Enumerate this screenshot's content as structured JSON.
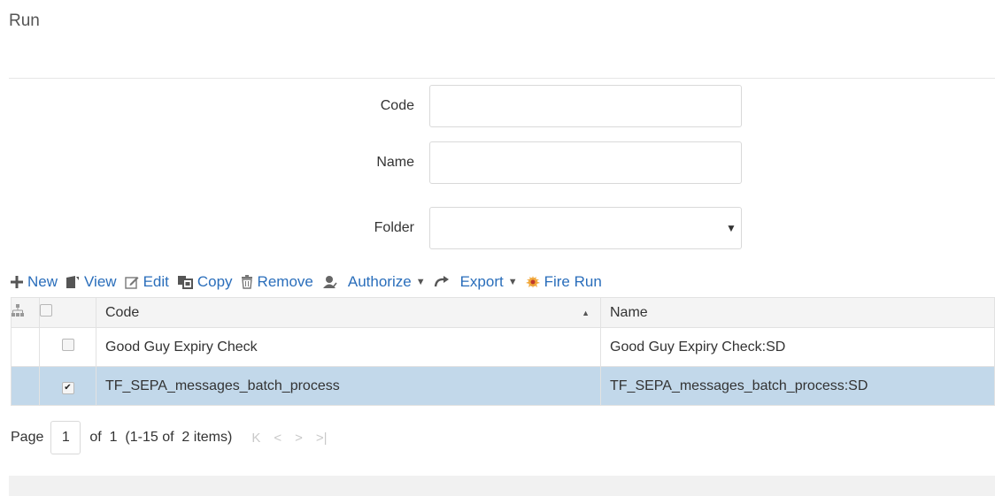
{
  "page": {
    "title": "Run"
  },
  "form": {
    "code_label": "Code",
    "code_value": "",
    "name_label": "Name",
    "name_value": "",
    "folder_label": "Folder",
    "folder_value": ""
  },
  "toolbar": {
    "new_label": "New",
    "view_label": "View",
    "edit_label": "Edit",
    "copy_label": "Copy",
    "remove_label": "Remove",
    "authorize_label": "Authorize",
    "export_label": "Export",
    "fire_run_label": "Fire Run"
  },
  "grid": {
    "columns": {
      "code": "Code",
      "name": "Name"
    },
    "rows": [
      {
        "code": "Good Guy Expiry Check",
        "name": "Good Guy Expiry Check:SD",
        "checked": false,
        "selected": false
      },
      {
        "code": "TF_SEPA_messages_batch_process",
        "name": "TF_SEPA_messages_batch_process:SD",
        "checked": true,
        "selected": true
      }
    ]
  },
  "pager": {
    "page_label": "Page",
    "current_page": "1",
    "of_text": "of  1  (1-15 of  2 items)"
  },
  "icons": {
    "new": "plus-icon",
    "view": "view-icon",
    "edit": "edit-icon",
    "copy": "copy-icon",
    "remove": "trash-icon",
    "authorize": "user-check-icon",
    "export": "export-arrow-icon",
    "fire_run": "fire-run-icon"
  },
  "colors": {
    "link": "#2a6ebb",
    "selected_row": "#c2d8ea",
    "header_bg": "#f4f4f4"
  }
}
